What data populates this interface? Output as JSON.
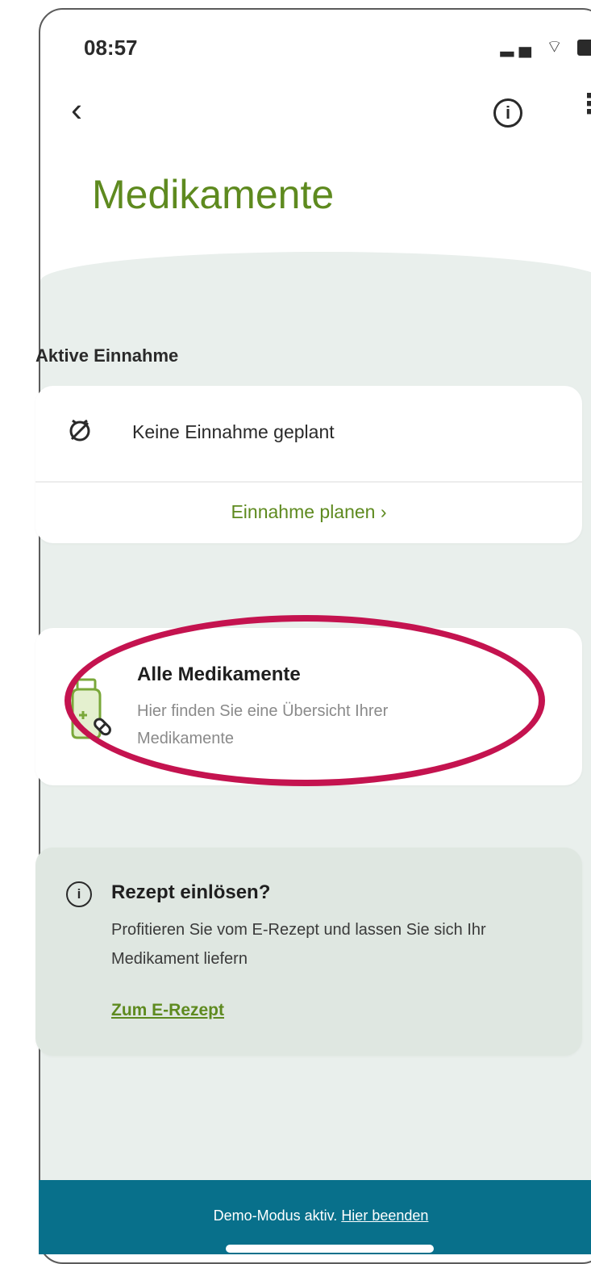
{
  "status_bar": {
    "time": "08:57"
  },
  "header": {
    "title": "Medikamente"
  },
  "section_label": "Aktive Einnahme",
  "plan_card": {
    "status_text": "Keine Einnahme geplant",
    "link_label": "Einnahme planen",
    "chevron": "›"
  },
  "meds_card": {
    "title": "Alle Medikamente",
    "description": "Hier finden Sie eine Übersicht Ihrer Medikamente"
  },
  "rezept_card": {
    "title": "Rezept einlösen?",
    "description": "Profitieren Sie vom E-Rezept und lassen Sie sich Ihr Medikament liefern",
    "link_label": "Zum E-Rezept"
  },
  "demo_bar": {
    "text": "Demo-Modus aktiv.",
    "link_label": "Hier beenden"
  },
  "colors": {
    "accent_green": "#5e8a1f",
    "highlight": "#c4134f",
    "demo_bar": "#08708b"
  },
  "icons": [
    "back-arrow-icon",
    "info-icon",
    "more-vertical-icon",
    "clock-off-icon",
    "medication-bottle-icon",
    "info-circle-icon"
  ]
}
